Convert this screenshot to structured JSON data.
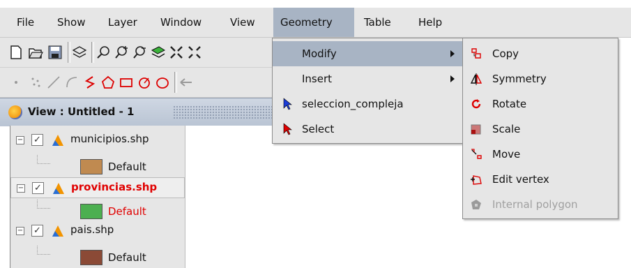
{
  "menubar": {
    "items": [
      "File",
      "Show",
      "Layer",
      "Window",
      "View",
      "Geometry",
      "Table",
      "Help"
    ],
    "active": "Geometry"
  },
  "view_window": {
    "title": "View : Untitled - 1"
  },
  "toc": {
    "layers": [
      {
        "name": "municipios.shp",
        "checked": true,
        "selected": false,
        "legend": "Default",
        "legend_color": "#c08a50"
      },
      {
        "name": "provincias.shp",
        "checked": true,
        "selected": true,
        "legend": "Default",
        "legend_color": "#4caf50"
      },
      {
        "name": "pais.shp",
        "checked": true,
        "selected": false,
        "legend": "Default",
        "legend_color": "#8b4a36"
      }
    ]
  },
  "geometry_menu": {
    "items": [
      {
        "label": "Modify",
        "submenu": true,
        "highlighted": true
      },
      {
        "label": "Insert",
        "submenu": true
      },
      {
        "label": "seleccion_compleja",
        "icon": "blue-cursor-icon"
      },
      {
        "label": "Select",
        "icon": "red-cursor-icon"
      }
    ]
  },
  "modify_submenu": {
    "items": [
      {
        "label": "Copy",
        "icon": "copy-icon",
        "enabled": true
      },
      {
        "label": "Symmetry",
        "icon": "symmetry-icon",
        "enabled": true
      },
      {
        "label": "Rotate",
        "icon": "rotate-icon",
        "enabled": true
      },
      {
        "label": "Scale",
        "icon": "scale-icon",
        "enabled": true
      },
      {
        "label": "Move",
        "icon": "move-icon",
        "enabled": true
      },
      {
        "label": "Edit vertex",
        "icon": "edit-vertex-icon",
        "enabled": true
      },
      {
        "label": "Internal polygon",
        "icon": "internal-polygon-icon",
        "enabled": false
      }
    ]
  },
  "colors": {
    "menu_bg": "#e6e6e6",
    "highlight": "#a8b4c4",
    "selected_layer_text": "#e00000"
  }
}
